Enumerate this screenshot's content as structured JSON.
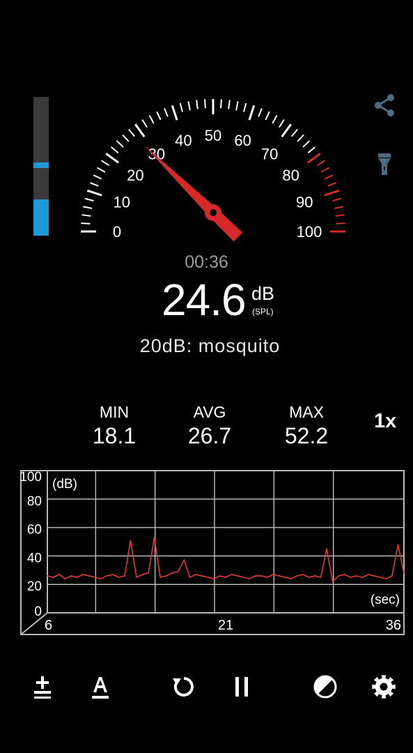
{
  "meter": {
    "timer": "00:36",
    "reading": "24.6",
    "unit": "dB",
    "unit_sub": "(SPL)",
    "description": "20dB: mosquito",
    "needle_value": 24.6,
    "level_fraction": 0.26,
    "peak_fraction": 0.51,
    "gauge_labels": [
      "0",
      "10",
      "20",
      "30",
      "40",
      "50",
      "60",
      "70",
      "80",
      "90",
      "100"
    ],
    "colors": {
      "needle": "#d42a2a",
      "danger_ticks": "#d42a2a",
      "ticks": "#ffffff",
      "level_bar": "#1e9bd4",
      "timer": "#9a9a9a"
    }
  },
  "stats": {
    "min_label": "MIN",
    "min_value": "18.1",
    "avg_label": "AVG",
    "avg_value": "26.7",
    "max_label": "MAX",
    "max_value": "52.2",
    "speed": "1x"
  },
  "chart_data": {
    "type": "line",
    "ylabel": "(dB)",
    "xlabel": "(sec)",
    "ylim": [
      0,
      100
    ],
    "xlim": [
      6,
      36
    ],
    "y_ticks": [
      "100",
      "80",
      "60",
      "40",
      "20",
      "0"
    ],
    "x_ticks": [
      "6",
      "21",
      "36"
    ],
    "grid": true,
    "line_color": "#e23a3a",
    "series": [
      {
        "x": [
          6,
          6.5,
          7,
          7.5,
          8,
          8.5,
          9,
          9.5,
          10,
          10.5,
          11,
          11.5,
          12,
          12.5,
          13,
          13.5,
          14,
          14.5,
          15,
          15.5,
          16,
          16.5,
          17,
          17.5,
          18,
          18.5,
          19,
          19.5,
          20,
          20.5,
          21,
          21.5,
          22,
          22.5,
          23,
          23.5,
          24,
          24.5,
          25,
          25.5,
          26,
          26.5,
          27,
          27.5,
          28,
          28.5,
          29,
          29.5,
          30,
          30.5,
          31,
          31.5,
          32,
          32.5,
          33,
          33.5,
          34,
          34.5,
          35,
          35.5,
          36
        ],
        "values": [
          26,
          25,
          27,
          24,
          26,
          25,
          27,
          26,
          25,
          24,
          26,
          27,
          25,
          26,
          51,
          25,
          27,
          28,
          53,
          25,
          26,
          28,
          29,
          37,
          25,
          27,
          26,
          25,
          24,
          26,
          25,
          27,
          26,
          25,
          24,
          26,
          26,
          25,
          27,
          26,
          25,
          24,
          26,
          27,
          25,
          26,
          25,
          45,
          22,
          26,
          27,
          25,
          26,
          25,
          27,
          26,
          25,
          24,
          26,
          48,
          28
        ]
      }
    ]
  },
  "toolbar": {
    "items": [
      "calibrate-icon",
      "text-icon",
      "reset-icon",
      "pause-icon",
      "theme-icon",
      "settings-icon"
    ]
  }
}
